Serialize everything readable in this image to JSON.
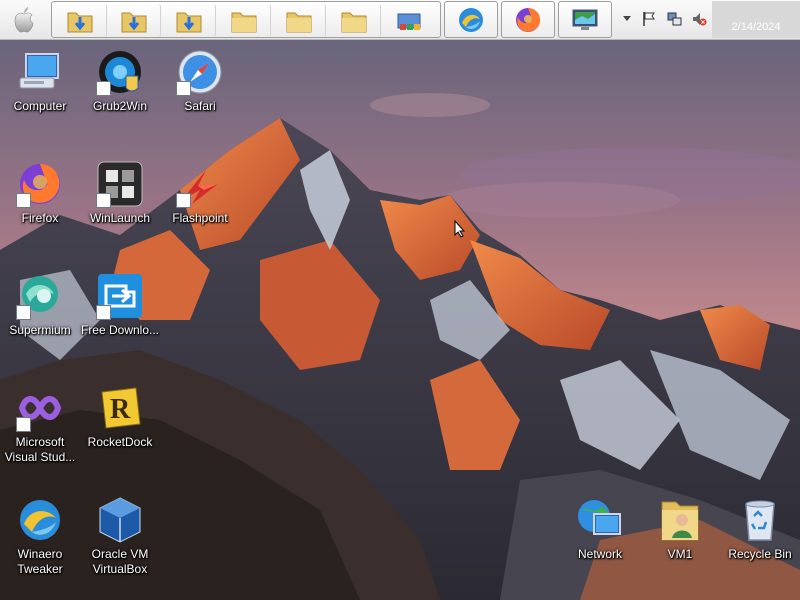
{
  "taskbar": {
    "start_icon": "apple-logo-icon",
    "quick_launch": [
      {
        "name": "downloads-folder-icon"
      },
      {
        "name": "downloads-folder-icon"
      },
      {
        "name": "downloads-folder-icon"
      },
      {
        "name": "folder-icon"
      },
      {
        "name": "folder-icon"
      },
      {
        "name": "folder-icon"
      },
      {
        "name": "control-panel-icon"
      }
    ],
    "running_apps": [
      "winaero-tweaker-icon",
      "firefox-icon",
      "monitor-icon"
    ],
    "tray": [
      "chevron-down-icon",
      "flag-icon",
      "network-icon",
      "volume-muted-icon"
    ],
    "clock": {
      "time": "",
      "date": "2/14/2024"
    }
  },
  "desktop": {
    "icons": [
      {
        "label": "Computer",
        "icon": "computer-icon",
        "shortcut": false
      },
      {
        "label": "Grub2Win",
        "icon": "grub2win-icon",
        "shortcut": true
      },
      {
        "label": "Safari",
        "icon": "safari-icon",
        "shortcut": true
      },
      {
        "label": "Firefox",
        "icon": "firefox-icon",
        "shortcut": true
      },
      {
        "label": "WinLaunch",
        "icon": "winlaunch-icon",
        "shortcut": true
      },
      {
        "label": "Flashpoint",
        "icon": "flashpoint-icon",
        "shortcut": true
      },
      {
        "label": "Supermium",
        "icon": "supermium-icon",
        "shortcut": true
      },
      {
        "label": "Free Downlo...",
        "icon": "free-download-manager-icon",
        "shortcut": true
      },
      {
        "label": "Microsoft Visual Stud...",
        "icon": "visual-studio-icon",
        "shortcut": true
      },
      {
        "label": "RocketDock",
        "icon": "rocketdock-icon",
        "shortcut": false
      },
      {
        "label": "Winaero Tweaker",
        "icon": "winaero-tweaker-icon",
        "shortcut": false
      },
      {
        "label": "Oracle VM VirtualBox",
        "icon": "virtualbox-icon",
        "shortcut": false
      },
      {
        "label": "Network",
        "icon": "network-icon",
        "shortcut": false
      },
      {
        "label": "VM1",
        "icon": "user-folder-icon",
        "shortcut": false
      },
      {
        "label": "Recycle Bin",
        "icon": "recycle-bin-icon",
        "shortcut": false
      }
    ]
  },
  "colors": {
    "sky_top": "#6a6a86",
    "sky_mid": "#b07c8a",
    "mountain_lit": "#e0663a",
    "mountain_shadow": "#3b3a48",
    "snow": "#c9cfdc"
  }
}
